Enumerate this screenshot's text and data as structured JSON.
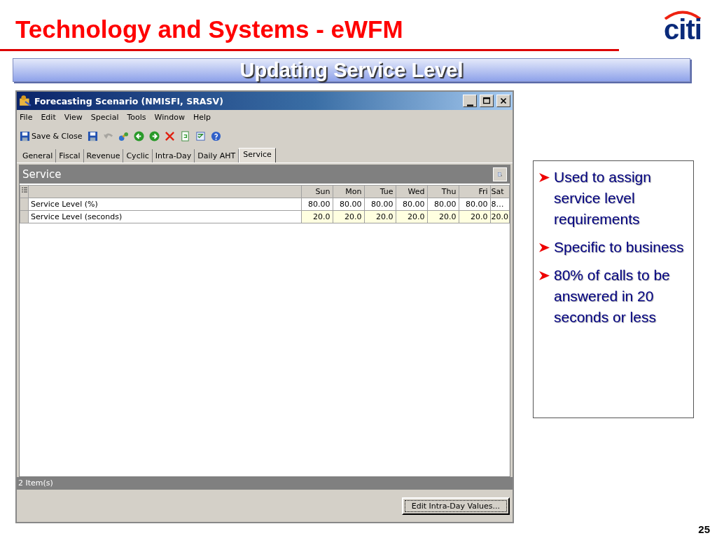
{
  "slide": {
    "title": "Technology and Systems - eWFM",
    "logo": "citi",
    "banner": "Updating Service Level",
    "page_number": "25"
  },
  "window": {
    "title": "Forecasting Scenario (NMISFI, SRASV)",
    "menu": [
      "File",
      "Edit",
      "View",
      "Special",
      "Tools",
      "Window",
      "Help"
    ],
    "toolbar": [
      {
        "kind": "save-close",
        "label": "Save & Close",
        "disabled": false
      },
      {
        "kind": "save",
        "disabled": false
      },
      {
        "kind": "undo",
        "disabled": true
      },
      {
        "kind": "link",
        "disabled": false
      },
      {
        "kind": "back",
        "disabled": false
      },
      {
        "kind": "forward",
        "disabled": false
      },
      {
        "kind": "delete",
        "disabled": false
      },
      {
        "kind": "refresh",
        "disabled": false
      },
      {
        "kind": "checklist",
        "disabled": false
      },
      {
        "kind": "help",
        "disabled": false
      }
    ],
    "tabs": [
      {
        "label": "General",
        "selected": false
      },
      {
        "label": "Fiscal",
        "selected": false
      },
      {
        "label": "Revenue",
        "selected": false
      },
      {
        "label": "Cyclic",
        "selected": false
      },
      {
        "label": "Intra-Day",
        "selected": false
      },
      {
        "label": "Daily AHT",
        "selected": false
      },
      {
        "label": "Service",
        "selected": true
      }
    ],
    "panel": {
      "title": "Service"
    },
    "table": {
      "columns": [
        "Sun",
        "Mon",
        "Tue",
        "Wed",
        "Thu",
        "Fri",
        "Sat"
      ],
      "rows": [
        {
          "name": "Service Level (%)",
          "editable": false,
          "values": [
            "80.00",
            "80.00",
            "80.00",
            "80.00",
            "80.00",
            "80.00",
            "8…"
          ]
        },
        {
          "name": "Service Level (seconds)",
          "editable": true,
          "values": [
            "20.0",
            "20.0",
            "20.0",
            "20.0",
            "20.0",
            "20.0",
            "20.0"
          ]
        }
      ]
    },
    "status_bar": "2 Item(s)",
    "button": "Edit Intra-Day Values..."
  },
  "notes": [
    "Used to assign service level requirements",
    "Specific to business",
    "80% of calls to be answered in 20 seconds or less"
  ]
}
